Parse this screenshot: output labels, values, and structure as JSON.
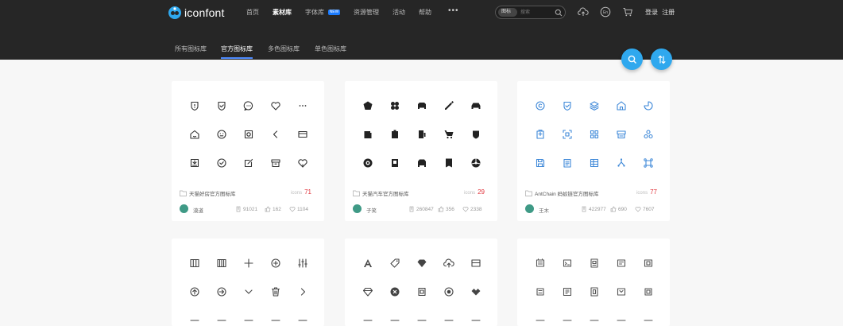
{
  "header": {
    "logo_text": "iconfont",
    "nav": [
      {
        "label": "首页",
        "active": false
      },
      {
        "label": "素材库",
        "active": true
      },
      {
        "label": "字体库",
        "active": false
      },
      {
        "label": "资源管理",
        "active": false
      },
      {
        "label": "活动",
        "active": false
      },
      {
        "label": "帮助",
        "active": false
      }
    ],
    "new_badge": "NEW",
    "more": "•••",
    "search": {
      "select_value": "图标",
      "placeholder": "搜索"
    },
    "login": "登录",
    "register": "注册"
  },
  "tabs": [
    {
      "label": "所有图标库",
      "active": false
    },
    {
      "label": "官方图标库",
      "active": true
    },
    {
      "label": "多色图标库",
      "active": false
    },
    {
      "label": "单色图标库",
      "active": false
    }
  ],
  "cards": [
    {
      "title": "天猫好房官方图标库",
      "count_label": "icons",
      "count": "71",
      "author": "漠道",
      "views": "91021",
      "likes": "162",
      "favorites": "1104",
      "style": "outline"
    },
    {
      "title": "天猫汽车官方图标库",
      "count_label": "icons",
      "count": "29",
      "author": "子笑",
      "views": "260847",
      "likes": "356",
      "favorites": "2338",
      "style": "solid"
    },
    {
      "title": "AntChain 蚂蚁链官方图标库",
      "count_label": "icons",
      "count": "77",
      "author": "王木",
      "views": "422977",
      "likes": "690",
      "favorites": "7607",
      "style": "blue"
    },
    {
      "title": "",
      "count_label": "",
      "count": "",
      "author": "",
      "views": "",
      "likes": "",
      "favorites": "",
      "style": "outline"
    },
    {
      "title": "",
      "count_label": "",
      "count": "",
      "author": "",
      "views": "",
      "likes": "",
      "favorites": "",
      "style": "mixed"
    },
    {
      "title": "",
      "count_label": "",
      "count": "",
      "author": "",
      "views": "",
      "likes": "",
      "favorites": "",
      "style": "outline"
    }
  ],
  "colors": {
    "header_bg": "#262626",
    "accent": "#4f8cff",
    "fab": "#2fa8ee",
    "count": "#e0323a",
    "ant_blue": "#3e88d8"
  }
}
